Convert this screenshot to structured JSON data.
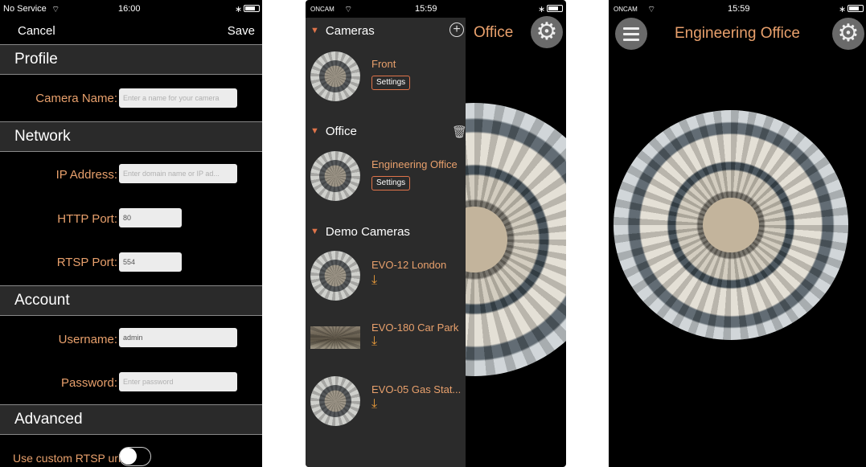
{
  "phone1": {
    "status": {
      "carrier": "No Service",
      "time": "16:00"
    },
    "nav": {
      "cancel": "Cancel",
      "save": "Save"
    },
    "sections": {
      "profile": "Profile",
      "network": "Network",
      "account": "Account",
      "advanced": "Advanced"
    },
    "fields": {
      "camera_name": {
        "label": "Camera Name:",
        "value": "",
        "placeholder": "Enter a name for your camera"
      },
      "ip_address": {
        "label": "IP Address:",
        "value": "",
        "placeholder": "Enter domain name or IP ad..."
      },
      "http_port": {
        "label": "HTTP Port:",
        "value": "80"
      },
      "rtsp_port": {
        "label": "RTSP Port:",
        "value": "554"
      },
      "username": {
        "label": "Username:",
        "value": "admin"
      },
      "password": {
        "label": "Password:",
        "value": "",
        "placeholder": "Enter password"
      }
    },
    "custom_rtsp": {
      "label": "Use custom RTSP url:"
    }
  },
  "phone2": {
    "status": {
      "carrier": "ONCAM",
      "time": "15:59"
    },
    "background_title": "Office",
    "groups": [
      {
        "name": "Cameras"
      },
      {
        "name": "Office"
      },
      {
        "name": "Demo Cameras"
      }
    ],
    "cameras": [
      {
        "name": "Front",
        "action": "Settings"
      },
      {
        "name": "Engineering Office",
        "action": "Settings"
      },
      {
        "name": "EVO-12 London"
      },
      {
        "name": "EVO-180 Car Park"
      },
      {
        "name": "EVO-05 Gas Stat..."
      }
    ]
  },
  "phone3": {
    "status": {
      "carrier": "ONCAM",
      "time": "15:59"
    },
    "title": "Engineering Office"
  },
  "colors": {
    "accent": "#e8a06c",
    "badge_border": "#e0744a"
  },
  "icons": [
    "wifi-icon",
    "bluetooth-icon",
    "battery-icon",
    "gear-icon",
    "menu-icon",
    "add-icon",
    "trash-icon",
    "download-icon"
  ]
}
